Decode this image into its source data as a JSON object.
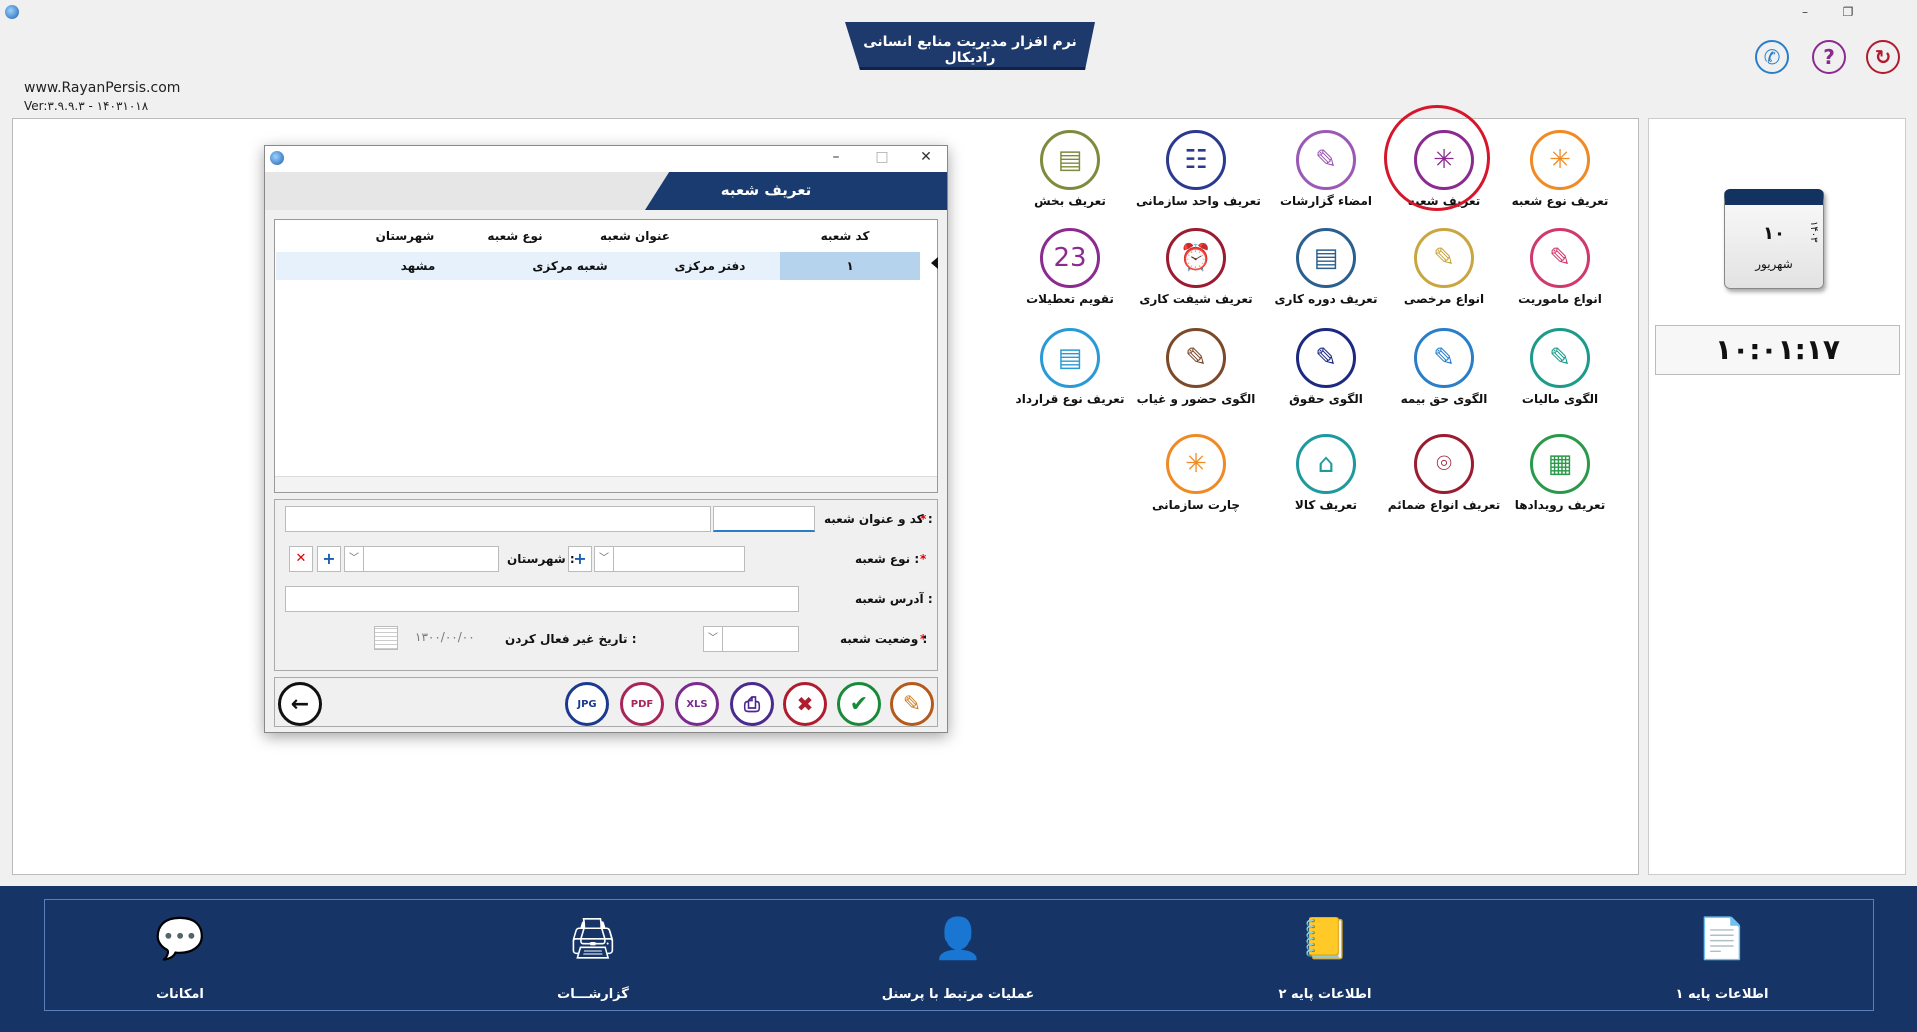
{
  "app": {
    "title": "نرم افزار مدیریت منابع انسانی رادیکال",
    "website": "www.RayanPersis.com",
    "version": "Ver:۳.۹.۹.۳ - ۱۴۰۳۱۰۱۸"
  },
  "window_controls": {
    "minimize": "–",
    "restore": "❐"
  },
  "top_icons": {
    "phone": "✆",
    "help": "?",
    "exit": "↻"
  },
  "date_widget": {
    "day": "۱۰",
    "month": "شهریور",
    "year": "۱۴۰۳"
  },
  "clock": "۱۰:۰۱:۱۷",
  "icons": [
    {
      "label": "تعریف نوع شعبه",
      "glyph": "✳",
      "color": "#f08a24"
    },
    {
      "label": "تعریف شعبه",
      "glyph": "✳",
      "color": "#8b2a8f"
    },
    {
      "label": "امضاء گزارشات",
      "glyph": "✎",
      "color": "#9b59b6"
    },
    {
      "label": "تعریف واحد سازمانی",
      "glyph": "☷",
      "color": "#2b3a8f"
    },
    {
      "label": "تعریف بخش",
      "glyph": "▤",
      "color": "#7f8a3c"
    },
    {
      "label": "انواع ماموریت",
      "glyph": "✎",
      "color": "#d03a6b"
    },
    {
      "label": "انواع مرخصی",
      "glyph": "✎",
      "color": "#c9a642"
    },
    {
      "label": "تعریف دوره کاری",
      "glyph": "▤",
      "color": "#2a5f8f"
    },
    {
      "label": "تعریف شیفت کاری",
      "glyph": "⏰",
      "color": "#9b1b30"
    },
    {
      "label": "تقویم تعطیلات",
      "glyph": "23",
      "color": "#8b2a8f"
    },
    {
      "label": "الگوی مالیات",
      "glyph": "✎",
      "color": "#1c9a8a"
    },
    {
      "label": "الگوی حق بیمه",
      "glyph": "✎",
      "color": "#2a7ec9"
    },
    {
      "label": "الگوی حقوق",
      "glyph": "✎",
      "color": "#1b2a80"
    },
    {
      "label": "الگوی حضور و غیاب",
      "glyph": "✎",
      "color": "#7b4a2a"
    },
    {
      "label": "تعریف نوع قرارداد",
      "glyph": "▤",
      "color": "#2a9ad6"
    },
    {
      "label": "تعریف رویدادها",
      "glyph": "▦",
      "color": "#2a9a4a"
    },
    {
      "label": "تعریف انواع ضمائم",
      "glyph": "⌾",
      "color": "#9b1b30"
    },
    {
      "label": "تعریف کالا",
      "glyph": "⌂",
      "color": "#1c9aa0"
    },
    {
      "label": "چارت سازمانی",
      "glyph": "✳",
      "color": "#f08a24"
    }
  ],
  "dialog": {
    "title": "تعریف شعبه",
    "controls": {
      "minimize": "–",
      "maximize": "□",
      "close": "✕"
    },
    "grid": {
      "headers": [
        "کد شعبه",
        "عنوان شعبه",
        "نوع شعبه",
        "شهرستان"
      ],
      "rows": [
        [
          "۱",
          "دفتر مرکزی",
          "شعبه مرکزی",
          "مشهد"
        ]
      ]
    },
    "form": {
      "code_title_label": "کد و عنوان شعبه :",
      "branch_type_label": "نوع شعبه :",
      "city_label": "شهرستان :",
      "address_label": "آدرس شعبه :",
      "status_label": "وضعیت شعبه :",
      "deactivation_date_label": "تاریخ غیر فعال کردن :",
      "deactivation_date_value": "۱۳۰۰/۰۰/۰۰",
      "required_mark": "*",
      "dropdown_arrow": "﹀",
      "add_glyph": "+",
      "remove_glyph": "✕"
    },
    "buttons": {
      "back": "←",
      "jpg": "JPG",
      "pdf": "PDF",
      "xls": "XLS",
      "print": "⎙",
      "delete": "✖",
      "confirm": "✔",
      "edit": "✎"
    }
  },
  "bottom_nav": [
    {
      "label": "اطلاعات پایه ۱",
      "glyph": "📄"
    },
    {
      "label": "اطلاعات پایه ۲",
      "glyph": "📒"
    },
    {
      "label": "عملیات مرتبط با پرسنل",
      "glyph": "👤"
    },
    {
      "label": "گزارشـــات",
      "glyph": "🖨"
    },
    {
      "label": "امکانات",
      "glyph": "💬"
    }
  ]
}
